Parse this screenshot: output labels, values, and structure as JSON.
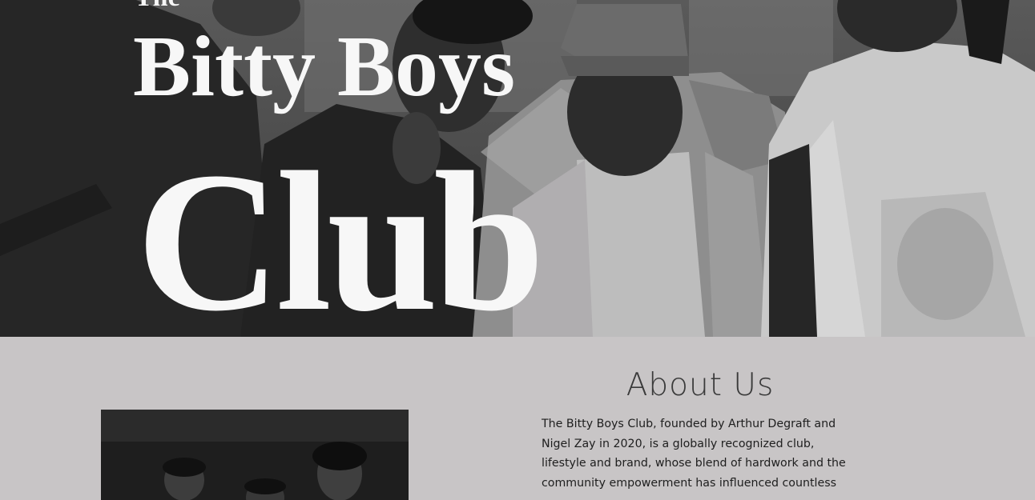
{
  "hero": {
    "title_prefix": "The",
    "title_line1": "Bitty Boys",
    "title_line2": "Club"
  },
  "about": {
    "heading": "About Us",
    "body": "The Bitty Boys Club, founded by Arthur Degraft and Nigel Zay in 2020, is a globally recognized club, lifestyle and brand, whose blend of hardwork and the community empowerment has influenced countless"
  },
  "icons": {
    "hero_image": "group-photo-image",
    "about_image": "members-photo-image"
  }
}
